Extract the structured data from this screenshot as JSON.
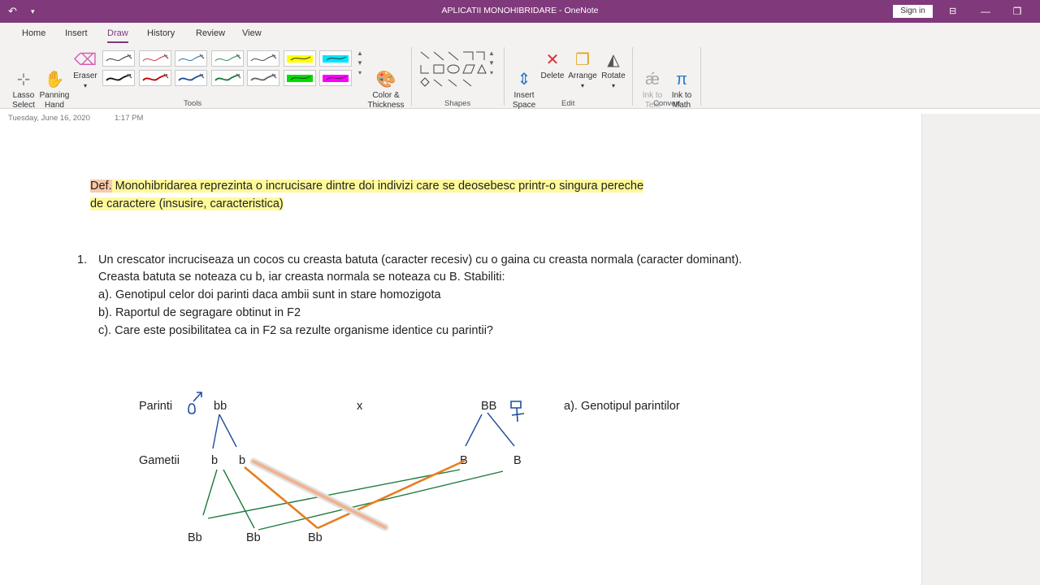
{
  "window": {
    "title": "APLICATII MONOHIBRIDARE  -  OneNote",
    "signin_label": "Sign in",
    "accent": "#80397b"
  },
  "menu": {
    "tabs": [
      "Home",
      "Insert",
      "Draw",
      "History",
      "Review",
      "View"
    ],
    "active": "Draw"
  },
  "ribbon": {
    "tools": {
      "lasso": "Lasso\nSelect",
      "panning": "Panning\nHand",
      "eraser": "Eraser",
      "color_thickness": "Color &\nThickness",
      "group": "Tools"
    },
    "pens": [
      "#333333",
      "#d13438",
      "#2b6cb0",
      "#2e8b57",
      "#444444",
      "#ffff00",
      "#00e5ff",
      "#111111",
      "#c00000",
      "#1f4e9c",
      "#1b7a3a",
      "#666666",
      "#00dd00",
      "#ff00ff"
    ],
    "shapes_group": "Shapes",
    "edit": {
      "insert_space": "Insert\nSpace",
      "delete": "Delete",
      "arrange": "Arrange",
      "rotate": "Rotate",
      "group": "Edit"
    },
    "convert": {
      "ink_to_text": "Ink to\nText",
      "ink_to_math": "Ink to\nMath",
      "group": "Convert"
    }
  },
  "page": {
    "date": "Tuesday, June 16, 2020",
    "time": "1:17 PM",
    "definition": {
      "prefix": "Def.",
      "line1": " Monohibridarea reprezinta o incrucisare dintre doi indivizi care se deosebesc printr-o singura pereche",
      "line2": "de caractere (insusire, caracteristica)"
    },
    "problem": {
      "number": "1.",
      "lines": [
        "Un crescator incruciseaza un cocos cu creasta batuta (caracter recesiv) cu o gaina cu creasta normala (caracter dominant).",
        "Creasta batuta se noteaza cu b, iar creasta normala se noteaza cu B. Stabiliti:",
        "a). Genotipul celor doi parinti daca ambii sunt in stare homozigota",
        "b). Raportul de segragare obtinut in F2",
        "c). Care este posibilitatea ca in F2 sa rezulte organisme identice cu parintii?"
      ]
    },
    "diagram": {
      "parinti_label": "Parinti",
      "male_genotype": "bb",
      "cross": "x",
      "female_genotype": "BB",
      "answer_a": "a). Genotipul parintilor",
      "gametii_label": "Gametii",
      "gametes": [
        "b",
        "b",
        "B",
        "B"
      ],
      "offspring": [
        "Bb",
        "Bb",
        "Bb"
      ]
    }
  }
}
